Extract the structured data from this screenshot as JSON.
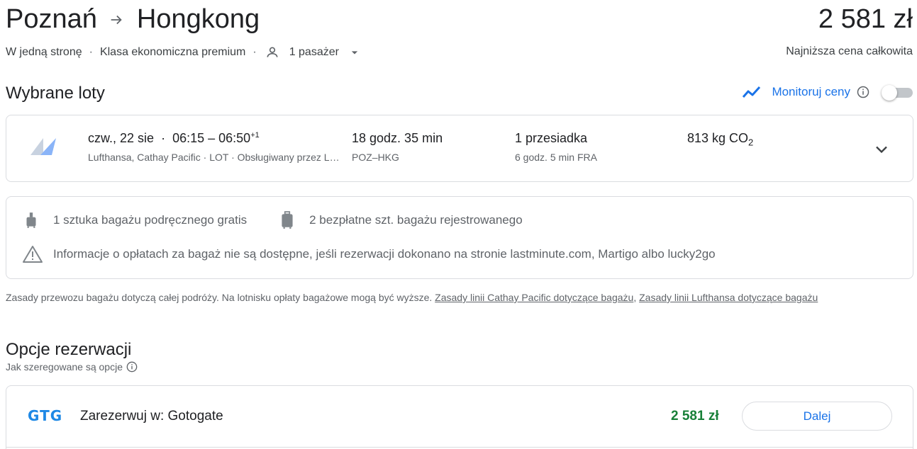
{
  "header": {
    "origin": "Poznań",
    "destination": "Hongkong",
    "total_price": "2 581 zł",
    "trip_type": "W jedną stronę",
    "cabin_class": "Klasa ekonomiczna premium",
    "passengers": "1 pasażer",
    "price_note": "Najniższa cena całkowita"
  },
  "selected_flights": {
    "title": "Wybrane loty",
    "monitor_label": "Monitoruj ceny",
    "monitor_enabled": false,
    "flight": {
      "date": "czw., 22 sie",
      "times": "06:15 – 06:50",
      "day_offset": "+1",
      "airlines": "Lufthansa, Cathay Pacific · LOT · Obsługiwany przez Lufthansa CityLine",
      "duration": "18 godz. 35 min",
      "route": "POZ–HKG",
      "stops": "1 przesiadka",
      "layover": "6 godz. 5 min FRA",
      "emissions_value": "813 kg CO",
      "emissions_sub": "2"
    }
  },
  "baggage": {
    "carry_on": "1 sztuka bagażu podręcznego gratis",
    "checked": "2 bezpłatne szt. bagażu rejestrowanego",
    "warning": "Informacje o opłatach za bagaż nie są dostępne, jeśli rezerwacji dokonano na stronie lastminute.com, Martigo albo lucky2go"
  },
  "policy": {
    "text": "Zasady przewozu bagażu dotyczą całej podróży. Na lotnisku opłaty bagażowe mogą być wyższe. ",
    "link_cathay": "Zasady linii Cathay Pacific dotyczące bagażu",
    "separator": ", ",
    "link_lufthansa": "Zasady linii Lufthansa dotyczące bagażu"
  },
  "booking_options": {
    "title": "Opcje rezerwacji",
    "subtitle": "Jak szeregowane są opcje",
    "options": [
      {
        "logo_text": "GTG",
        "label": "Zarezerwuj w: Gotogate",
        "price": "2 581 zł",
        "button": "Dalej"
      }
    ]
  },
  "colors": {
    "accent": "#1a73e8",
    "price_green": "#188038",
    "border": "#dadce0",
    "secondary_text": "#5f6368"
  }
}
